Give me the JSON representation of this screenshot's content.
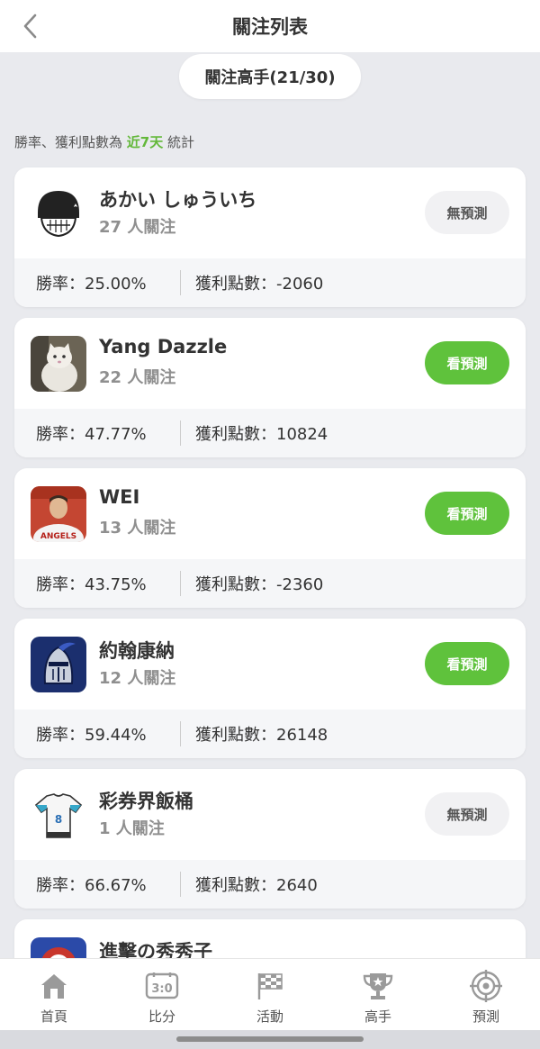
{
  "header": {
    "title": "關注列表"
  },
  "tab": {
    "label": "關注高手(21/30)"
  },
  "note": {
    "prefix": "勝率、獲利點數為 ",
    "highlight": "近7天",
    "suffix": " 統計"
  },
  "colors": {
    "accent_green": "#5fc23c",
    "background": "#e9eaee"
  },
  "experts": [
    {
      "name": "あかい しゅういち",
      "followers": "27 人關注",
      "button": "無預測",
      "has_prediction": false,
      "win_rate": "勝率：25.00%",
      "points": "獲利點數：-2060",
      "avatar": "black-helmet-avatar"
    },
    {
      "name": "Yang Dazzle",
      "followers": "22 人關注",
      "button": "看預測",
      "has_prediction": true,
      "win_rate": "勝率：47.77%",
      "points": "獲利點數：10824",
      "avatar": "white-cat-avatar"
    },
    {
      "name": "WEI",
      "followers": "13 人關注",
      "button": "看預測",
      "has_prediction": true,
      "win_rate": "勝率：43.75%",
      "points": "獲利點數：-2360",
      "avatar": "angels-player-avatar"
    },
    {
      "name": "約翰康納",
      "followers": "12 人關注",
      "button": "看預測",
      "has_prediction": true,
      "win_rate": "勝率：59.44%",
      "points": "獲利點數：26148",
      "avatar": "knight-helmet-avatar"
    },
    {
      "name": "彩券界飯桶",
      "followers": "1 人關注",
      "button": "無預測",
      "has_prediction": false,
      "win_rate": "勝率：66.67%",
      "points": "獲利點數：2640",
      "avatar": "jersey-avatar"
    },
    {
      "name": "進擊の秀秀子",
      "avatar": "team-logo-avatar"
    }
  ],
  "tabbar": [
    {
      "label": "首頁",
      "icon": "home-icon"
    },
    {
      "label": "比分",
      "icon": "scoreboard-icon"
    },
    {
      "label": "活動",
      "icon": "checkered-flag-icon"
    },
    {
      "label": "高手",
      "icon": "trophy-icon"
    },
    {
      "label": "預測",
      "icon": "target-icon"
    }
  ]
}
